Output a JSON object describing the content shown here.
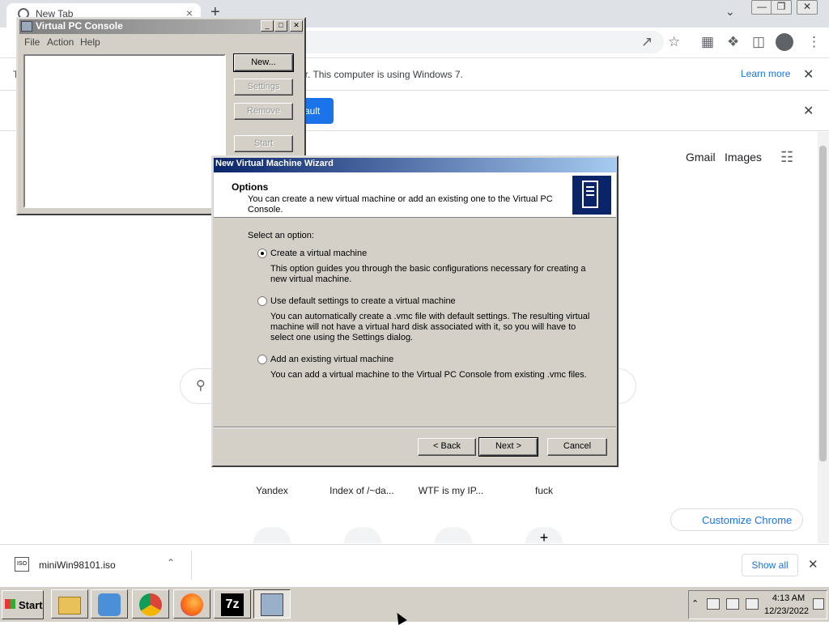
{
  "chrome": {
    "tab_title": "New Tab",
    "tab_close": "×",
    "new_tab": "+",
    "infobar_prefix": "T",
    "infobar_text": "er. This computer is using Windows 7.",
    "learn_more": "Learn more",
    "infobar_close": "✕",
    "default_btn_suffix": "ault",
    "default_close": "✕",
    "gmail": "Gmail",
    "images": "Images",
    "shortcuts": [
      "Yandex",
      "Index of /~da...",
      "WTF is my IP...",
      "fuck"
    ],
    "add_shortcut": "+",
    "customize": "Customize Chrome",
    "accent": "#1a73e8"
  },
  "download_shelf": {
    "filename": "miniWin98101.iso",
    "show_all": "Show all",
    "close": "✕"
  },
  "vpc_console": {
    "title": "Virtual PC Console",
    "menu": [
      "File",
      "Action",
      "Help"
    ],
    "buttons": {
      "new": "New...",
      "settings": "Settings",
      "remove": "Remove",
      "start": "Start"
    }
  },
  "wizard": {
    "title": "New Virtual Machine Wizard",
    "header_title": "Options",
    "header_desc": "You can create a new virtual machine or add an existing one to the Virtual PC Console.",
    "select_label": "Select an option:",
    "options": [
      {
        "label": "Create a virtual machine",
        "desc": "This option guides you through the basic configurations necessary for creating a new virtual machine.",
        "selected": true
      },
      {
        "label": "Use default settings to create a virtual machine",
        "desc": "You can automatically create a .vmc file with default settings. The resulting virtual machine will not have a virtual hard disk associated with it, so you will have to select one using the Settings dialog.",
        "selected": false
      },
      {
        "label": "Add an existing virtual machine",
        "desc": "You can add a virtual machine to the Virtual PC Console from existing .vmc files.",
        "selected": false
      }
    ],
    "back": "< Back",
    "next": "Next >",
    "cancel": "Cancel"
  },
  "taskbar": {
    "start": "Start",
    "apps": [
      "file-explorer",
      "media-player",
      "chrome",
      "firefox",
      "7-zip",
      "virtual-pc"
    ],
    "sevenzip_label": "7z",
    "clock_time": "4:13 AM",
    "clock_date": "12/23/2022"
  }
}
